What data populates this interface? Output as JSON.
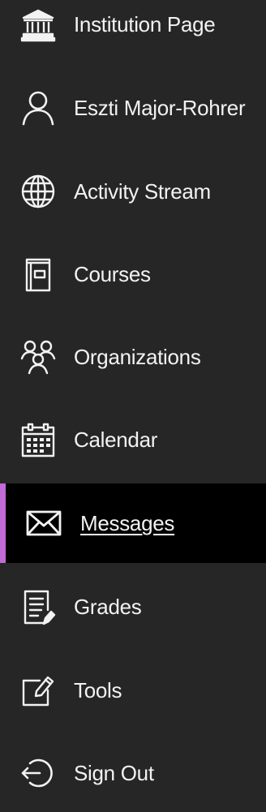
{
  "colors": {
    "background": "#262626",
    "active_background": "#000000",
    "accent": "#c26ad6",
    "text": "#f2f2f2"
  },
  "nav": {
    "items": [
      {
        "label": "Institution Page",
        "icon": "institution-icon",
        "active": false
      },
      {
        "label": "Eszti Major-Rohrer",
        "icon": "user-profile-icon",
        "active": false
      },
      {
        "label": "Activity Stream",
        "icon": "globe-icon",
        "active": false
      },
      {
        "label": "Courses",
        "icon": "courses-icon",
        "active": false
      },
      {
        "label": "Organizations",
        "icon": "organizations-icon",
        "active": false
      },
      {
        "label": "Calendar",
        "icon": "calendar-icon",
        "active": false
      },
      {
        "label": "Messages",
        "icon": "envelope-icon",
        "active": true
      },
      {
        "label": "Grades",
        "icon": "grades-icon",
        "active": false
      },
      {
        "label": "Tools",
        "icon": "tools-icon",
        "active": false
      },
      {
        "label": "Sign Out",
        "icon": "sign-out-icon",
        "active": false
      }
    ]
  }
}
